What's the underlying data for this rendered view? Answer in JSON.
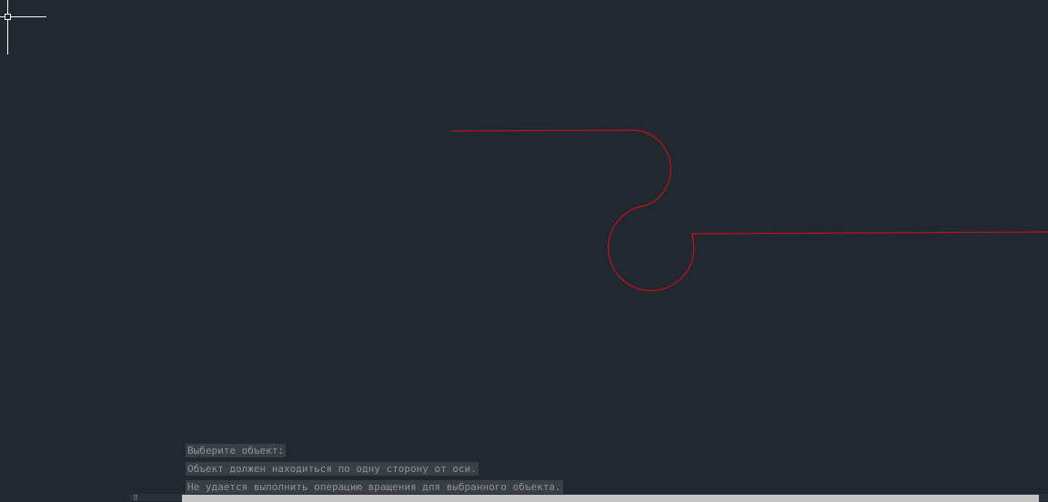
{
  "drawing": {
    "stroke_color": "#c0121e",
    "crosshair_color": "#ffffff"
  },
  "command_history": [
    "Выберите объект:",
    "Объект должен находиться по одну сторону от оси.",
    "Не удается выполнить операцию вращения для выбранного объекта."
  ],
  "command_line": {
    "value": ""
  }
}
